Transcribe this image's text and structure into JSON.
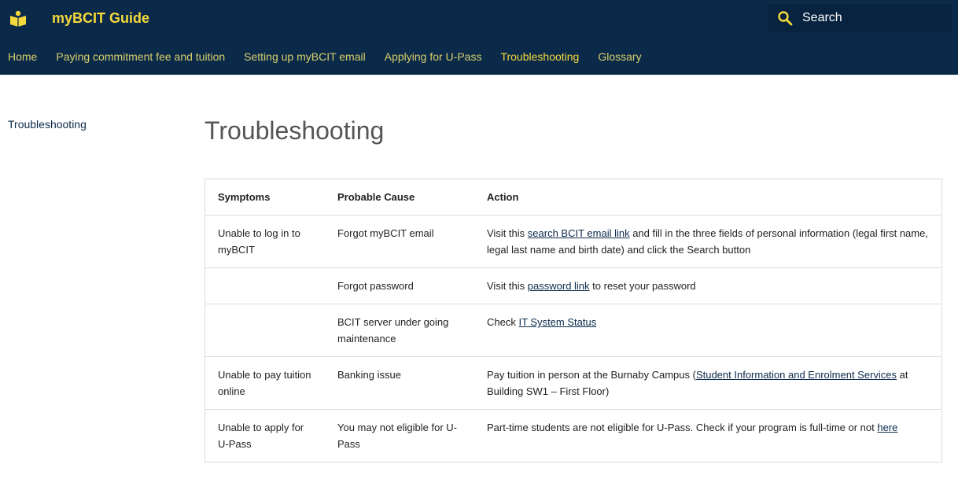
{
  "header": {
    "title": "myBCIT Guide",
    "logo_icon": "book-reader-icon",
    "brand_color": "#0b2a4a",
    "accent_color": "#f5d93b"
  },
  "search": {
    "placeholder": "Search",
    "icon": "search-icon"
  },
  "nav": {
    "tabs": [
      {
        "label": "Home"
      },
      {
        "label": "Paying commitment fee and tuition"
      },
      {
        "label": "Setting up myBCIT email"
      },
      {
        "label": "Applying for U-Pass"
      },
      {
        "label": "Troubleshooting",
        "active": true
      },
      {
        "label": "Glossary"
      }
    ]
  },
  "sidebar": {
    "items": [
      {
        "label": "Troubleshooting"
      }
    ]
  },
  "main": {
    "title": "Troubleshooting",
    "table": {
      "headers": [
        "Symptoms",
        "Probable Cause",
        "Action"
      ],
      "rows": [
        {
          "symptom": "Unable to log in to myBCIT",
          "cause": "Forgot myBCIT email",
          "action_pre": "Visit this ",
          "action_link": "search BCIT email link",
          "action_post": " and fill in the three fields of personal information (legal first name, legal last name and birth date) and click the Search button"
        },
        {
          "symptom": "",
          "cause": "Forgot password",
          "action_pre": "Visit this ",
          "action_link": "password link",
          "action_post": " to reset your password"
        },
        {
          "symptom": "",
          "cause": "BCIT server under going maintenance",
          "action_pre": "Check ",
          "action_link": "IT System Status",
          "action_post": ""
        },
        {
          "symptom": "Unable to pay tuition online",
          "cause": "Banking issue",
          "action_pre": "Pay tuition in person at the Burnaby Campus (",
          "action_link": "Student Information and Enrolment Services",
          "action_post": " at Building SW1 – First Floor)"
        },
        {
          "symptom": "Unable to apply for U-Pass",
          "cause": "You may not eligible for U-Pass",
          "action_pre": "Part-time students are not eligible for U-Pass. Check if your program is full-time or not ",
          "action_link": "here",
          "action_post": ""
        }
      ]
    }
  }
}
